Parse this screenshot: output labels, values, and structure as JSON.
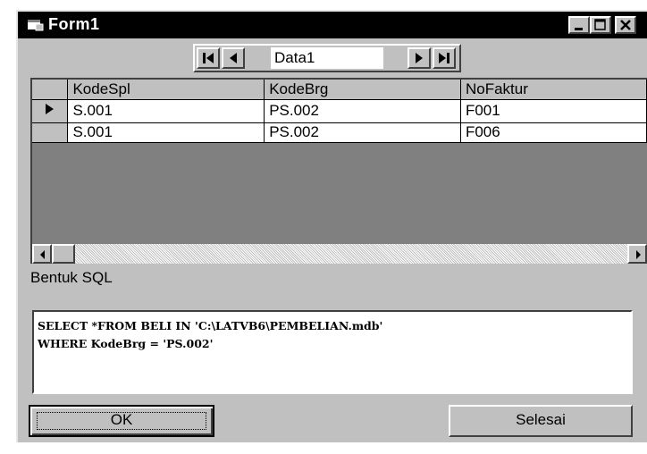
{
  "window": {
    "title": "Form1"
  },
  "data_control": {
    "caption": "Data1"
  },
  "grid": {
    "columns": [
      "KodeSpl",
      "KodeBrg",
      "NoFaktur"
    ],
    "rows": [
      {
        "KodeSpl": "S.001",
        "KodeBrg": "PS.002",
        "NoFaktur": "F001"
      },
      {
        "KodeSpl": "S.001",
        "KodeBrg": "PS.002",
        "NoFaktur": "F006"
      }
    ],
    "current_row_marker": "▶"
  },
  "sql": {
    "label": "Bentuk SQL",
    "lines": [
      "SELECT *FROM BELI IN 'C:\\LATVB6\\PEMBELIAN.mdb'",
      "WHERE KodeBrg = 'PS.002'"
    ]
  },
  "buttons": {
    "ok": "OK",
    "selesai": "Selesai"
  },
  "icons": [
    "form-icon",
    "minimize-icon",
    "maximize-icon",
    "close-icon",
    "first-record-icon",
    "prev-record-icon",
    "next-record-icon",
    "last-record-icon",
    "scroll-left-icon",
    "scroll-right-icon"
  ]
}
